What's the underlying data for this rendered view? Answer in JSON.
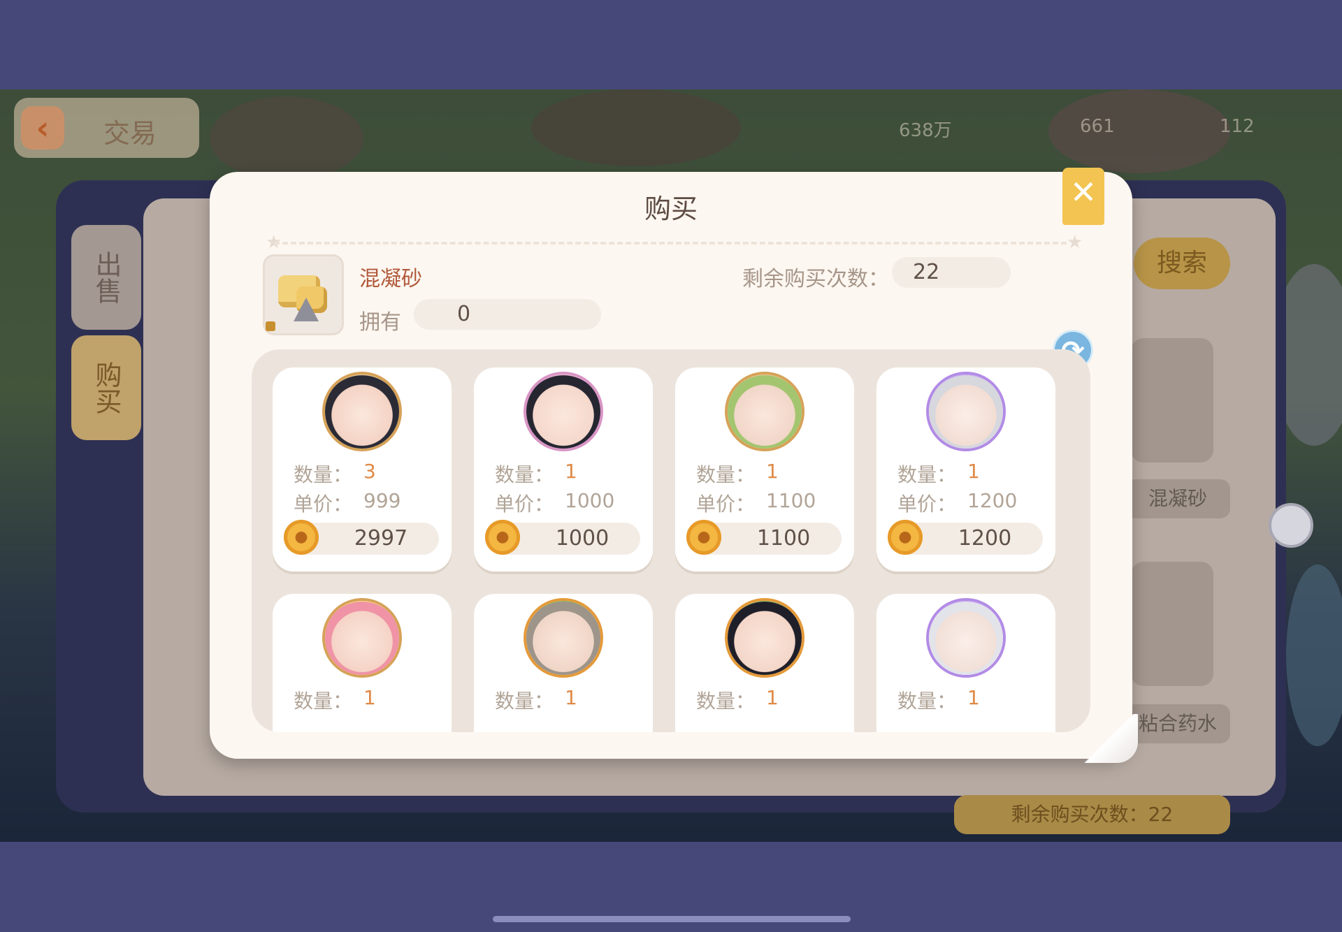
{
  "topbar": {
    "back_label": "交易",
    "res_coins": "638万",
    "res_b": "661",
    "res_c": "112"
  },
  "background": {
    "tab_sell": "出售",
    "tab_buy": "购买",
    "search_label": "搜索",
    "side_item_1": "混凝砂",
    "side_item_2": "粘合药水",
    "remaining_bottom": "剩余购买次数：22"
  },
  "modal": {
    "title": "购买",
    "close_icon": "close-icon",
    "item": {
      "name": "混凝砂",
      "own_label": "拥有",
      "own_value": "0"
    },
    "remaining_label": "剩余购买次数：",
    "remaining_value": "22",
    "listings": [
      {
        "qty_label": "数量：",
        "qty": "3",
        "price_label": "单价：",
        "price": "999",
        "total": "2997"
      },
      {
        "qty_label": "数量：",
        "qty": "1",
        "price_label": "单价：",
        "price": "1000",
        "total": "1000"
      },
      {
        "qty_label": "数量：",
        "qty": "1",
        "price_label": "单价：",
        "price": "1100",
        "total": "1100"
      },
      {
        "qty_label": "数量：",
        "qty": "1",
        "price_label": "单价：",
        "price": "1200",
        "total": "1200"
      },
      {
        "qty_label": "数量：",
        "qty": "1"
      },
      {
        "qty_label": "数量：",
        "qty": "1"
      },
      {
        "qty_label": "数量：",
        "qty": "1"
      },
      {
        "qty_label": "数量：",
        "qty": "1"
      }
    ]
  },
  "colors": {
    "accent_orange": "#e08a47",
    "coin_gold": "#f3b742",
    "close_yellow": "#f3c451",
    "title_brown": "#5d4c43"
  }
}
